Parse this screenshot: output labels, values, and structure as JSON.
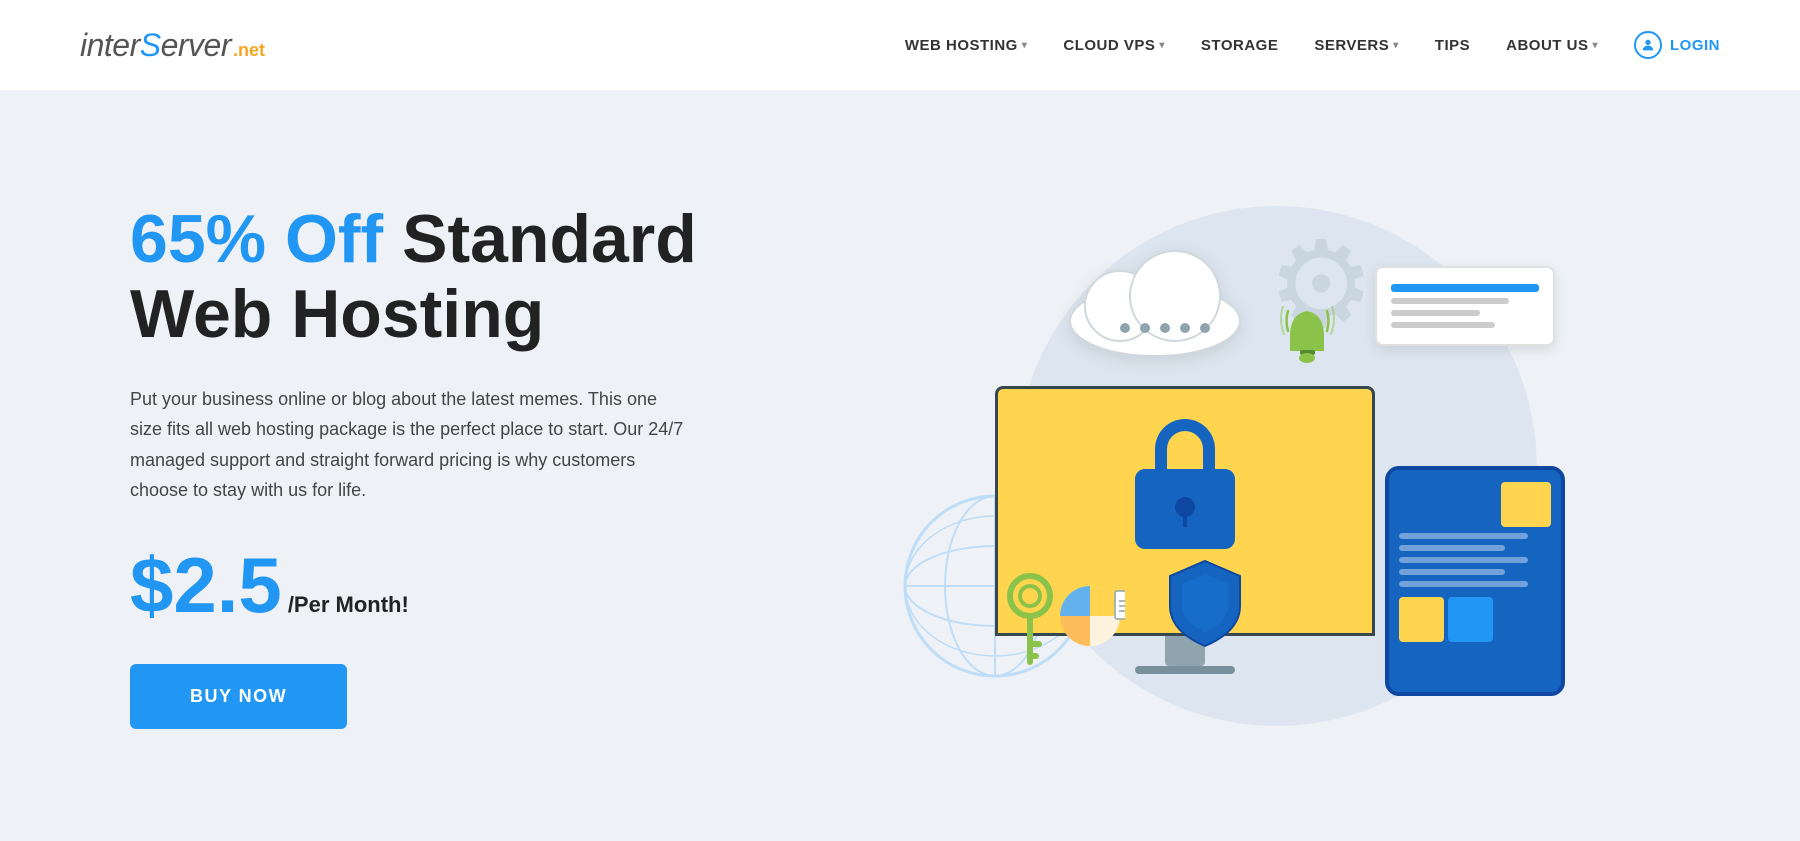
{
  "logo": {
    "prefix": "inter",
    "cursor_letter": "S",
    "suffix": "erver",
    "tld": ".net"
  },
  "nav": {
    "items": [
      {
        "label": "WEB HOSTING",
        "has_dropdown": true
      },
      {
        "label": "CLOUD VPS",
        "has_dropdown": true
      },
      {
        "label": "STORAGE",
        "has_dropdown": false
      },
      {
        "label": "SERVERS",
        "has_dropdown": true
      },
      {
        "label": "TIPS",
        "has_dropdown": false
      },
      {
        "label": "ABOUT US",
        "has_dropdown": true
      }
    ],
    "login_label": "LOGIN"
  },
  "hero": {
    "headline_part1": "65% Off",
    "headline_part2": "Standard\nWeb Hosting",
    "description": "Put your business online or blog about the latest memes. This one size fits all web hosting package is the perfect place to start. Our 24/7 managed support and straight forward pricing is why customers choose to stay with us for life.",
    "price_amount": "$2.5",
    "price_suffix": "/Per Month!",
    "cta_label": "BUY NOW"
  },
  "colors": {
    "blue": "#2196f3",
    "dark_blue": "#1565c0",
    "orange": "#f5a623",
    "yellow": "#ffd54f",
    "dark": "#222222",
    "gray": "#444444",
    "bg": "#eef1f6",
    "header_bg": "#ffffff"
  }
}
